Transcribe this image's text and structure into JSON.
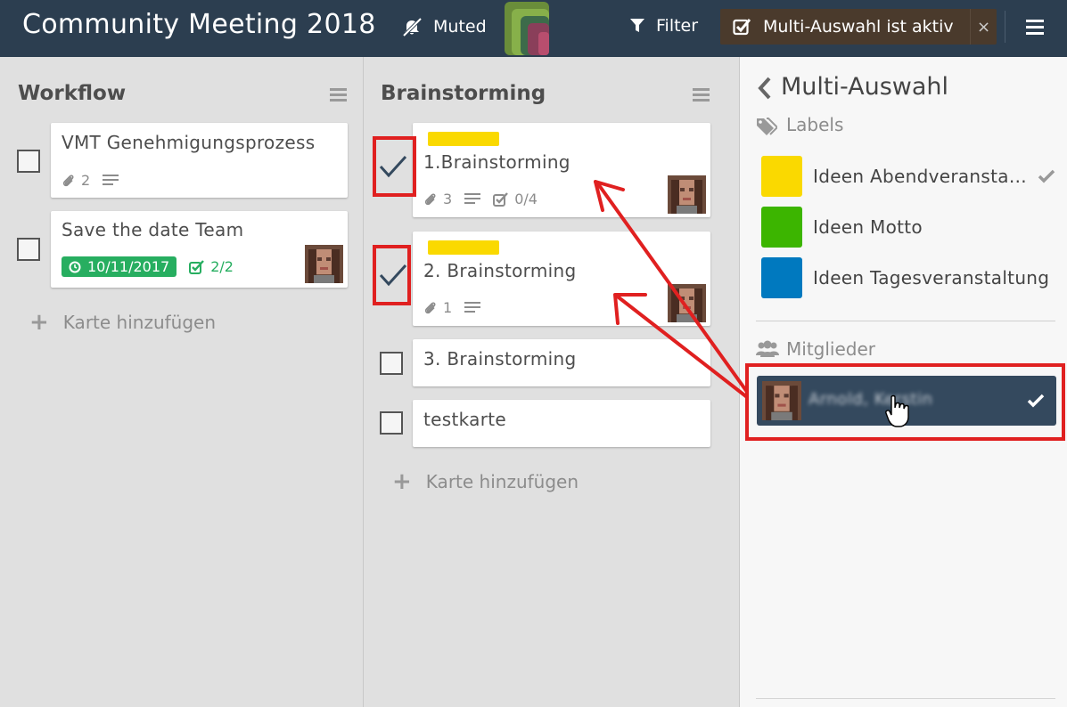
{
  "header": {
    "board_title": "Community Meeting 2018",
    "muted_label": "Muted",
    "filter_label": "Filter",
    "multi_select_label": "Multi-Auswahl ist aktiv",
    "close_label": "×"
  },
  "lists": [
    {
      "title": "Workflow",
      "cards": [
        {
          "title": "VMT Genehmigungsprozess",
          "attachments": "2",
          "has_description": true
        },
        {
          "title": "Save the date Team",
          "due_date": "10/11/2017",
          "checklist": "2/2",
          "has_avatar": true
        }
      ],
      "add_card_label": "Karte hinzufügen"
    },
    {
      "title": "Brainstorming",
      "cards": [
        {
          "title": "1.Brainstorming",
          "label_color": "#fad900",
          "attachments": "3",
          "has_description": true,
          "checklist": "0/4",
          "selected": true,
          "has_avatar": true
        },
        {
          "title": "2. Brainstorming",
          "label_color": "#fad900",
          "attachments": "1",
          "has_description": true,
          "selected": true,
          "has_avatar": true
        },
        {
          "title": "3. Brainstorming",
          "selected": false
        },
        {
          "title": "testkarte",
          "selected": false
        }
      ],
      "add_card_label": "Karte hinzufügen"
    }
  ],
  "sidebar": {
    "title": "Multi-Auswahl",
    "labels_heading": "Labels",
    "labels": [
      {
        "name": "Ideen Abendveransta…",
        "color": "#fad900",
        "checked": true
      },
      {
        "name": "Ideen Motto",
        "color": "#3cb500",
        "checked": false
      },
      {
        "name": "Ideen Tagesveranstaltung",
        "color": "#0079bf",
        "checked": false
      }
    ],
    "members_heading": "Mitglieder",
    "members": [
      {
        "name": "Arnold, Kerstin",
        "checked": true
      }
    ]
  },
  "colors": {
    "header_bg": "#2c3e50",
    "banner_bg": "#4a3a2c",
    "annotation_red": "#e02020",
    "member_bg": "#34495e"
  }
}
